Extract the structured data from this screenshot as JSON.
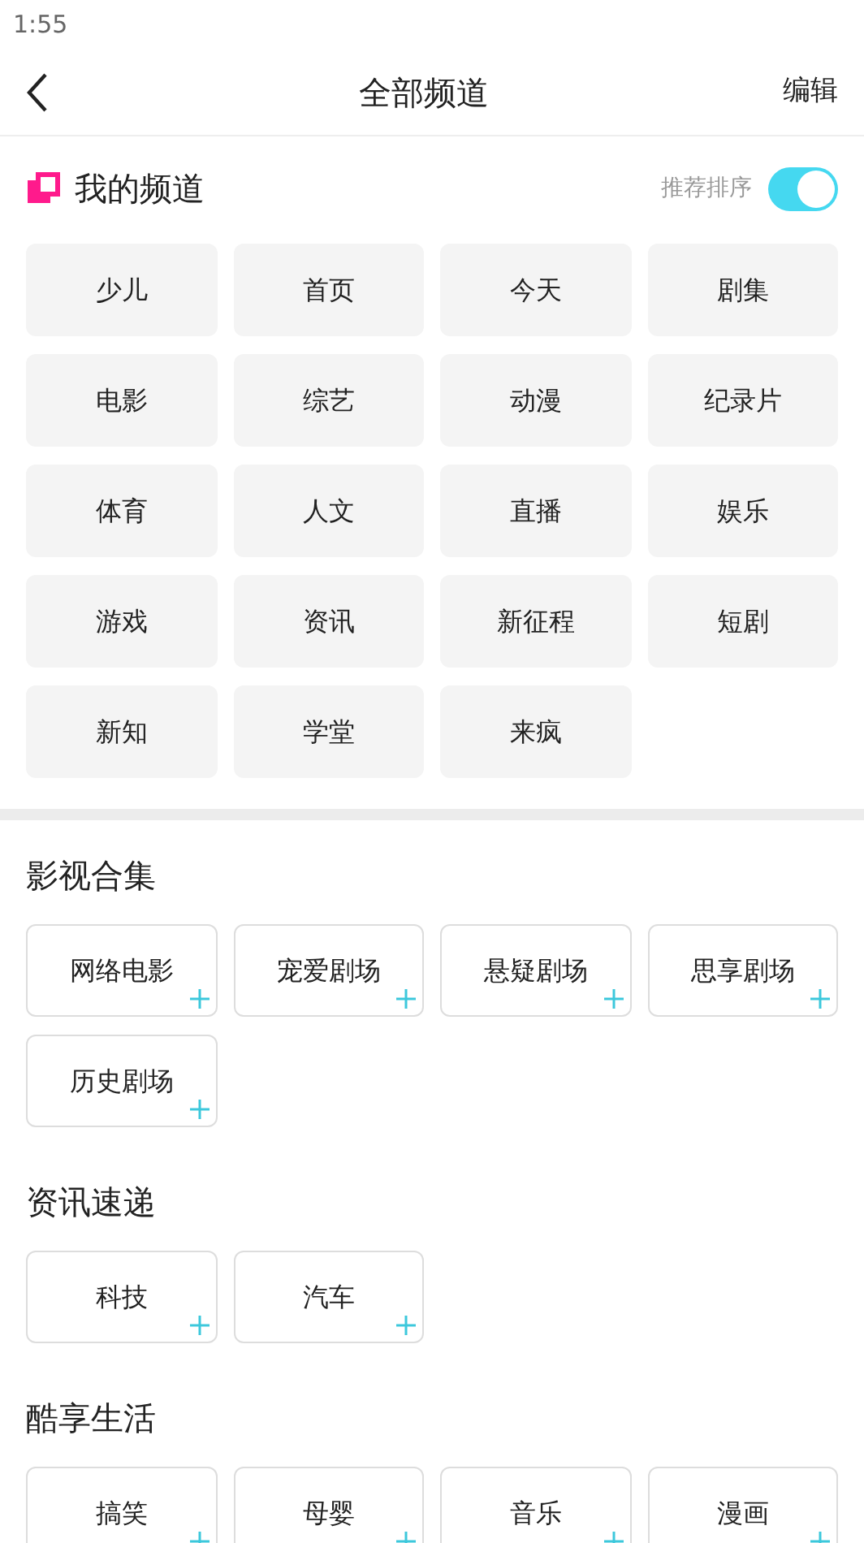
{
  "status_bar": {
    "time": "1:55"
  },
  "header": {
    "title": "全部频道",
    "action": "编辑"
  },
  "my_channels": {
    "title": "我的频道",
    "sort_label": "推荐排序",
    "sort_on": true,
    "channels": [
      "少儿",
      "首页",
      "今天",
      "剧集",
      "电影",
      "综艺",
      "动漫",
      "纪录片",
      "体育",
      "人文",
      "直播",
      "娱乐",
      "游戏",
      "资讯",
      "新征程",
      "短剧",
      "新知",
      "学堂",
      "来疯"
    ]
  },
  "sections": [
    {
      "title": "影视合集",
      "channels": [
        "网络电影",
        "宠爱剧场",
        "悬疑剧场",
        "思享剧场",
        "历史剧场"
      ]
    },
    {
      "title": "资讯速递",
      "channels": [
        "科技",
        "汽车"
      ]
    },
    {
      "title": "酷享生活",
      "channels": [
        "搞笑",
        "母婴",
        "音乐",
        "漫画"
      ]
    }
  ]
}
